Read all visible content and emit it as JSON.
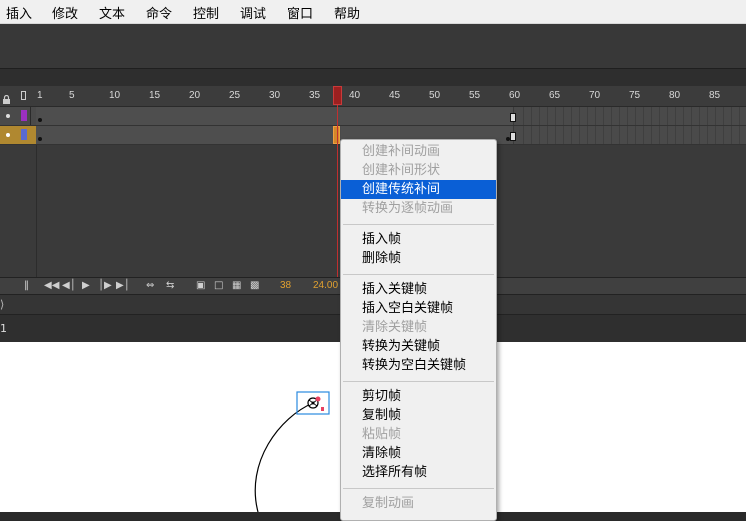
{
  "menubar": {
    "items": [
      "插入",
      "修改",
      "文本",
      "命令",
      "控制",
      "调试",
      "窗口",
      "帮助"
    ]
  },
  "timeline": {
    "ruler_labels": [
      "1",
      "5",
      "10",
      "15",
      "20",
      "25",
      "30",
      "35",
      "40",
      "45",
      "50",
      "55",
      "60",
      "65",
      "70",
      "75",
      "80",
      "85"
    ],
    "current_frame": "38",
    "fps": "24.00"
  },
  "scene": {
    "label": "1"
  },
  "context_menu": {
    "groups": [
      [
        {
          "label": "创建补间动画",
          "enabled": false
        },
        {
          "label": "创建补间形状",
          "enabled": false
        },
        {
          "label": "创建传统补间",
          "enabled": true,
          "selected": true
        },
        {
          "label": "转换为逐帧动画",
          "enabled": false
        }
      ],
      [
        {
          "label": "插入帧",
          "enabled": true
        },
        {
          "label": "删除帧",
          "enabled": true
        }
      ],
      [
        {
          "label": "插入关键帧",
          "enabled": true
        },
        {
          "label": "插入空白关键帧",
          "enabled": true
        },
        {
          "label": "清除关键帧",
          "enabled": false
        },
        {
          "label": "转换为关键帧",
          "enabled": true
        },
        {
          "label": "转换为空白关键帧",
          "enabled": true
        }
      ],
      [
        {
          "label": "剪切帧",
          "enabled": true
        },
        {
          "label": "复制帧",
          "enabled": true
        },
        {
          "label": "粘贴帧",
          "enabled": false
        },
        {
          "label": "清除帧",
          "enabled": true
        },
        {
          "label": "选择所有帧",
          "enabled": true
        }
      ],
      [
        {
          "label": "复制动画",
          "enabled": false
        }
      ]
    ]
  },
  "colors": {
    "selection": "#0a5fd6",
    "layer1_color": "#9b30c0",
    "layer2_color": "#5a6ad0",
    "active_layer": "#b08830",
    "playhead": "#c03030",
    "frame_counter": "#e0a030"
  }
}
